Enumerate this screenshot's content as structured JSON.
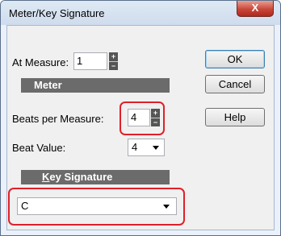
{
  "window": {
    "title": "Meter/Key Signature",
    "close_label": "X"
  },
  "at_measure": {
    "label": "At Measure:",
    "value": "1"
  },
  "meter": {
    "heading": "Meter",
    "beats_label": "Beats per Measure:",
    "beats_value": "4",
    "beat_value_label": "Beat Value:",
    "beat_value": "4"
  },
  "key_signature": {
    "heading_underline": "K",
    "heading_rest": "ey Signature",
    "value": "C"
  },
  "buttons": {
    "ok": "OK",
    "cancel": "Cancel",
    "help": "Help"
  },
  "colors": {
    "highlight": "#e0202a",
    "section_bar": "#6b6b6b",
    "close": "#c9473a"
  }
}
